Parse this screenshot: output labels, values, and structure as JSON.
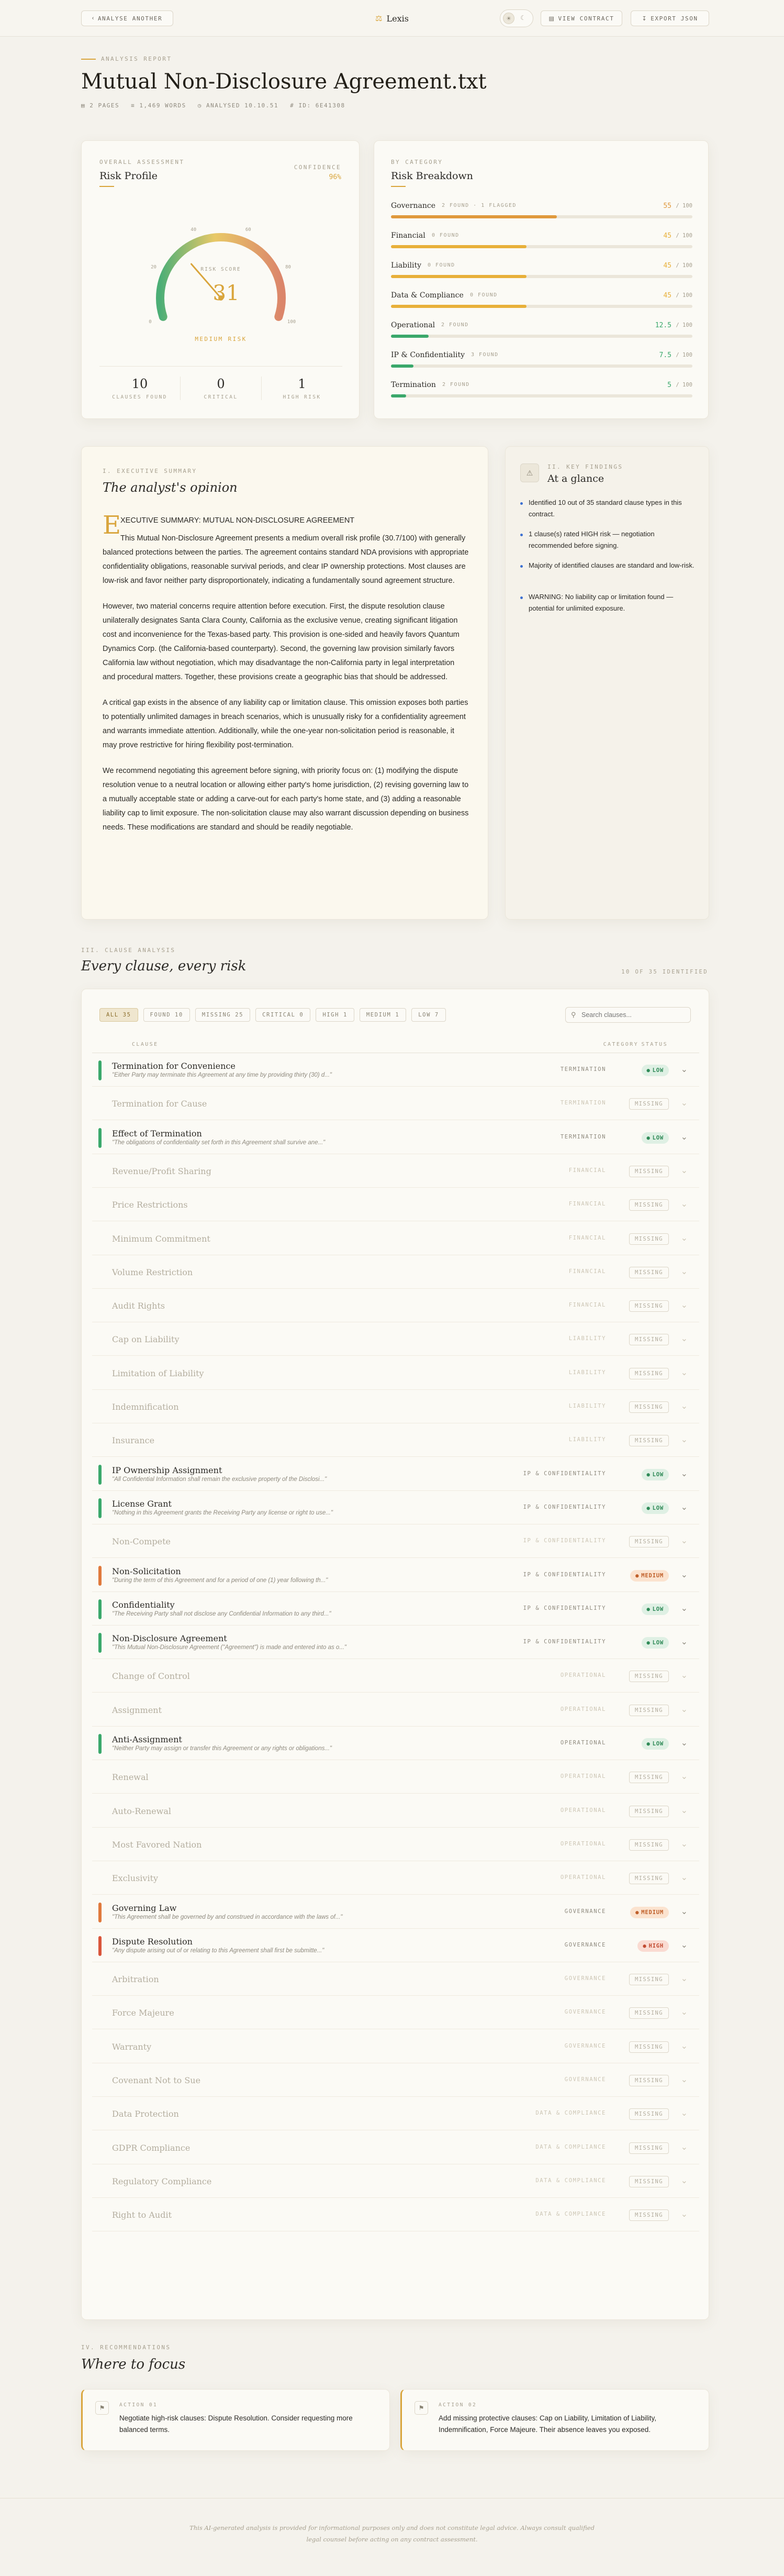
{
  "topbar": {
    "back_label": "ANALYSE ANOTHER",
    "brand": "Lexis",
    "view_contract": "VIEW CONTRACT",
    "export": "EXPORT JSON"
  },
  "header": {
    "eyebrow": "ANALYSIS REPORT",
    "title": "Mutual Non-Disclosure Agreement.txt",
    "meta": [
      "2 PAGES",
      "1,469 WORDS",
      "ANALYSED 10.10.51",
      "ID: 6E41308"
    ]
  },
  "risk_profile": {
    "eyebrow": "OVERALL ASSESSMENT",
    "title": "Risk Profile",
    "confidence_label": "CONFIDENCE",
    "confidence_value": "96%",
    "gauge": {
      "label": "RISK SCORE",
      "score": "31",
      "score_value": 31,
      "level": "MEDIUM RISK",
      "ticks": [
        "0",
        "20",
        "40",
        "60",
        "80",
        "100"
      ]
    },
    "stats": [
      {
        "value": "10",
        "label": "CLAUSES FOUND"
      },
      {
        "value": "0",
        "label": "CRITICAL"
      },
      {
        "value": "1",
        "label": "HIGH RISK"
      }
    ]
  },
  "breakdown": {
    "eyebrow": "BY CATEGORY",
    "title": "Risk Breakdown",
    "categories": [
      {
        "name": "Governance",
        "found": "2 FOUND · 1 FLAGGED",
        "score": "55",
        "max": "/ 100",
        "pct": 0.55,
        "color": "#e0993c"
      },
      {
        "name": "Financial",
        "found": "0 FOUND",
        "score": "45",
        "max": "/ 100",
        "pct": 0.45,
        "color": "#e8b03a"
      },
      {
        "name": "Liability",
        "found": "0 FOUND",
        "score": "45",
        "max": "/ 100",
        "pct": 0.45,
        "color": "#e8b03a"
      },
      {
        "name": "Data & Compliance",
        "found": "0 FOUND",
        "score": "45",
        "max": "/ 100",
        "pct": 0.45,
        "color": "#e8b03a"
      },
      {
        "name": "Operational",
        "found": "2 FOUND",
        "score": "12.5",
        "max": "/ 100",
        "pct": 0.125,
        "color": "#3aa86b"
      },
      {
        "name": "IP & Confidentiality",
        "found": "3 FOUND",
        "score": "7.5",
        "max": "/ 100",
        "pct": 0.075,
        "color": "#3aa86b"
      },
      {
        "name": "Termination",
        "found": "2 FOUND",
        "score": "5",
        "max": "/ 100",
        "pct": 0.05,
        "color": "#3aa86b"
      }
    ]
  },
  "summary": {
    "eyebrow": "I. EXECUTIVE SUMMARY",
    "title": "The analyst's opinion",
    "dropcap": "E",
    "lead": "XECUTIVE SUMMARY: MUTUAL NON-DISCLOSURE AGREEMENT",
    "p1": "This Mutual Non-Disclosure Agreement presents a medium overall risk profile (30.7/100) with generally balanced protections between the parties. The agreement contains standard NDA provisions with appropriate confidentiality obligations, reasonable survival periods, and clear IP ownership protections. Most clauses are low-risk and favor neither party disproportionately, indicating a fundamentally sound agreement structure.",
    "p2": "However, two material concerns require attention before execution. First, the dispute resolution clause unilaterally designates Santa Clara County, California as the exclusive venue, creating significant litigation cost and inconvenience for the Texas-based party. This provision is one-sided and heavily favors Quantum Dynamics Corp. (the California-based counterparty). Second, the governing law provision similarly favors California law without negotiation, which may disadvantage the non-California party in legal interpretation and procedural matters. Together, these provisions create a geographic bias that should be addressed.",
    "p3": "A critical gap exists in the absence of any liability cap or limitation clause. This omission exposes both parties to potentially unlimited damages in breach scenarios, which is unusually risky for a confidentiality agreement and warrants immediate attention. Additionally, while the one-year non-solicitation period is reasonable, it may prove restrictive for hiring flexibility post-termination.",
    "p4": "We recommend negotiating this agreement before signing, with priority focus on: (1) modifying the dispute resolution venue to a neutral location or allowing either party's home jurisdiction, (2) revising governing law to a mutually acceptable state or adding a carve-out for each party's home state, and (3) adding a reasonable liability cap to limit exposure. The non-solicitation clause may also warrant discussion depending on business needs. These modifications are standard and should be readily negotiable."
  },
  "findings": {
    "eyebrow": "II. KEY FINDINGS",
    "title": "At a glance",
    "items": [
      "Identified 10 out of 35 standard clause types in this contract.",
      "1 clause(s) rated HIGH risk — negotiation recommended before signing.",
      "Majority of identified clauses are standard and low-risk.",
      "WARNING: No liability cap or limitation found — potential for unlimited exposure."
    ]
  },
  "clauses": {
    "eyebrow": "III. CLAUSE ANALYSIS",
    "title": "Every clause, every risk",
    "count": "10 OF 35 IDENTIFIED",
    "filters": [
      "ALL 35",
      "FOUND 10",
      "MISSING 25",
      "CRITICAL 0",
      "HIGH 1",
      "MEDIUM 1",
      "LOW 7"
    ],
    "search_placeholder": "Search clauses...",
    "col_clause": "CLAUSE",
    "col_category": "CATEGORY",
    "col_status": "STATUS",
    "rows": [
      {
        "title": "Termination for Convenience",
        "quote": "\"Either Party may terminate this Agreement at any time by providing thirty (30) d...\"",
        "category": "TERMINATION",
        "status": "LOW",
        "level": "low"
      },
      {
        "title": "Termination for Cause",
        "quote": "",
        "category": "TERMINATION",
        "status": "MISSING",
        "level": "missing"
      },
      {
        "title": "Effect of Termination",
        "quote": "\"The obligations of confidentiality set forth in this Agreement shall survive ane...\"",
        "category": "TERMINATION",
        "status": "LOW",
        "level": "low"
      },
      {
        "title": "Revenue/Profit Sharing",
        "quote": "",
        "category": "FINANCIAL",
        "status": "MISSING",
        "level": "missing"
      },
      {
        "title": "Price Restrictions",
        "quote": "",
        "category": "FINANCIAL",
        "status": "MISSING",
        "level": "missing"
      },
      {
        "title": "Minimum Commitment",
        "quote": "",
        "category": "FINANCIAL",
        "status": "MISSING",
        "level": "missing"
      },
      {
        "title": "Volume Restriction",
        "quote": "",
        "category": "FINANCIAL",
        "status": "MISSING",
        "level": "missing"
      },
      {
        "title": "Audit Rights",
        "quote": "",
        "category": "FINANCIAL",
        "status": "MISSING",
        "level": "missing"
      },
      {
        "title": "Cap on Liability",
        "quote": "",
        "category": "LIABILITY",
        "status": "MISSING",
        "level": "missing"
      },
      {
        "title": "Limitation of Liability",
        "quote": "",
        "category": "LIABILITY",
        "status": "MISSING",
        "level": "missing"
      },
      {
        "title": "Indemnification",
        "quote": "",
        "category": "LIABILITY",
        "status": "MISSING",
        "level": "missing"
      },
      {
        "title": "Insurance",
        "quote": "",
        "category": "LIABILITY",
        "status": "MISSING",
        "level": "missing"
      },
      {
        "title": "IP Ownership Assignment",
        "quote": "\"All Confidential Information shall remain the exclusive property of the Disclosi...\"",
        "category": "IP & CONFIDENTIALITY",
        "status": "LOW",
        "level": "low"
      },
      {
        "title": "License Grant",
        "quote": "\"Nothing in this Agreement grants the Receiving Party any license or right to use...\"",
        "category": "IP & CONFIDENTIALITY",
        "status": "LOW",
        "level": "low"
      },
      {
        "title": "Non-Compete",
        "quote": "",
        "category": "IP & CONFIDENTIALITY",
        "status": "MISSING",
        "level": "missing"
      },
      {
        "title": "Non-Solicitation",
        "quote": "\"During the term of this Agreement and for a period of one (1) year following th...\"",
        "category": "IP & CONFIDENTIALITY",
        "status": "MEDIUM",
        "level": "medium"
      },
      {
        "title": "Confidentiality",
        "quote": "\"The Receiving Party shall not disclose any Confidential Information to any third...\"",
        "category": "IP & CONFIDENTIALITY",
        "status": "LOW",
        "level": "low"
      },
      {
        "title": "Non-Disclosure Agreement",
        "quote": "\"This Mutual Non-Disclosure Agreement (\"Agreement\") is made and entered into as o...\"",
        "category": "IP & CONFIDENTIALITY",
        "status": "LOW",
        "level": "low"
      },
      {
        "title": "Change of Control",
        "quote": "",
        "category": "OPERATIONAL",
        "status": "MISSING",
        "level": "missing"
      },
      {
        "title": "Assignment",
        "quote": "",
        "category": "OPERATIONAL",
        "status": "MISSING",
        "level": "missing"
      },
      {
        "title": "Anti-Assignment",
        "quote": "\"Neither Party may assign or transfer this Agreement or any rights or obligations...\"",
        "category": "OPERATIONAL",
        "status": "LOW",
        "level": "low"
      },
      {
        "title": "Renewal",
        "quote": "",
        "category": "OPERATIONAL",
        "status": "MISSING",
        "level": "missing"
      },
      {
        "title": "Auto-Renewal",
        "quote": "",
        "category": "OPERATIONAL",
        "status": "MISSING",
        "level": "missing"
      },
      {
        "title": "Most Favored Nation",
        "quote": "",
        "category": "OPERATIONAL",
        "status": "MISSING",
        "level": "missing"
      },
      {
        "title": "Exclusivity",
        "quote": "",
        "category": "OPERATIONAL",
        "status": "MISSING",
        "level": "missing"
      },
      {
        "title": "Governing Law",
        "quote": "\"This Agreement shall be governed by and construed in accordance with the laws of...\"",
        "category": "GOVERNANCE",
        "status": "MEDIUM",
        "level": "medium"
      },
      {
        "title": "Dispute Resolution",
        "quote": "\"Any dispute arising out of or relating to this Agreement shall first be submitte...\"",
        "category": "GOVERNANCE",
        "status": "HIGH",
        "level": "high"
      },
      {
        "title": "Arbitration",
        "quote": "",
        "category": "GOVERNANCE",
        "status": "MISSING",
        "level": "missing"
      },
      {
        "title": "Force Majeure",
        "quote": "",
        "category": "GOVERNANCE",
        "status": "MISSING",
        "level": "missing"
      },
      {
        "title": "Warranty",
        "quote": "",
        "category": "GOVERNANCE",
        "status": "MISSING",
        "level": "missing"
      },
      {
        "title": "Covenant Not to Sue",
        "quote": "",
        "category": "GOVERNANCE",
        "status": "MISSING",
        "level": "missing"
      },
      {
        "title": "Data Protection",
        "quote": "",
        "category": "DATA & COMPLIANCE",
        "status": "MISSING",
        "level": "missing"
      },
      {
        "title": "GDPR Compliance",
        "quote": "",
        "category": "DATA & COMPLIANCE",
        "status": "MISSING",
        "level": "missing"
      },
      {
        "title": "Regulatory Compliance",
        "quote": "",
        "category": "DATA & COMPLIANCE",
        "status": "MISSING",
        "level": "missing"
      },
      {
        "title": "Right to Audit",
        "quote": "",
        "category": "DATA & COMPLIANCE",
        "status": "MISSING",
        "level": "missing"
      }
    ]
  },
  "recommendations": {
    "eyebrow": "IV. RECOMMENDATIONS",
    "title": "Where to focus",
    "items": [
      {
        "label": "ACTION 01",
        "text": "Negotiate high-risk clauses: Dispute Resolution. Consider requesting more balanced terms."
      },
      {
        "label": "ACTION 02",
        "text": "Add missing protective clauses: Cap on Liability, Limitation of Liability, Indemnification, Force Majeure. Their absence leaves you exposed."
      }
    ]
  },
  "footer": {
    "line1": "This AI-generated analysis is provided for informational purposes only and does not constitute legal advice. Always consult qualified",
    "line2": "legal counsel before acting on any contract assessment."
  },
  "colors": {
    "low": "#3aa86b",
    "medium": "#e0793c",
    "high": "#d9553a",
    "accent": "#d9a53c"
  }
}
